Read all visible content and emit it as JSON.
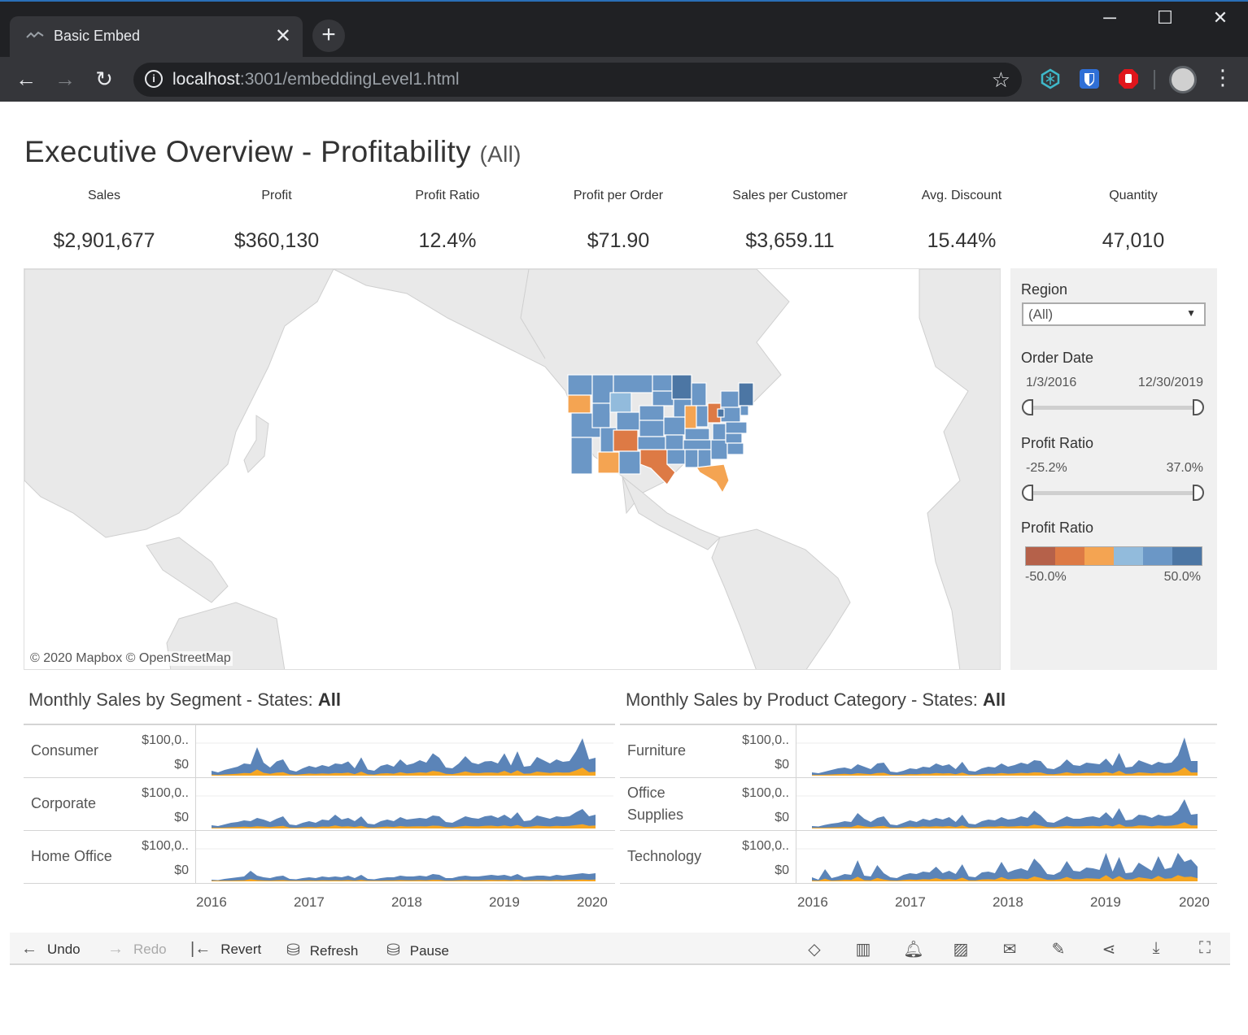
{
  "browser": {
    "tab_title": "Basic Embed",
    "url_host": "localhost",
    "url_rest": ":3001/embeddingLevel1.html"
  },
  "dashboard": {
    "title": "Executive Overview - Profitability",
    "title_suffix": "(All)",
    "kpis": [
      {
        "label": "Sales",
        "value": "$2,901,677"
      },
      {
        "label": "Profit",
        "value": "$360,130"
      },
      {
        "label": "Profit Ratio",
        "value": "12.4%"
      },
      {
        "label": "Profit per Order",
        "value": "$71.90"
      },
      {
        "label": "Sales per Customer",
        "value": "$3,659.11"
      },
      {
        "label": "Avg. Discount",
        "value": "15.44%"
      },
      {
        "label": "Quantity",
        "value": "47,010"
      }
    ],
    "map_attribution": "© 2020 Mapbox  © OpenStreetMap",
    "filters": {
      "region_label": "Region",
      "region_value": "(All)",
      "order_date_label": "Order Date",
      "order_date_min": "1/3/2016",
      "order_date_max": "12/30/2019",
      "profit_ratio_label": "Profit Ratio",
      "profit_ratio_min": "-25.2%",
      "profit_ratio_max": "37.0%",
      "legend_label": "Profit Ratio",
      "legend_min": "-50.0%",
      "legend_max": "50.0%",
      "legend_colors": [
        "#b5614a",
        "#dd7a45",
        "#f4a452",
        "#92bbdc",
        "#6b97c6",
        "#4c76a4"
      ]
    },
    "segment_chart": {
      "title_prefix": "Monthly Sales by Segment - States: ",
      "title_value": "All",
      "rows": [
        "Consumer",
        "Corporate",
        "Home Office"
      ],
      "y_top": "$100,0..",
      "y_bottom": "$0"
    },
    "category_chart": {
      "title_prefix": "Monthly Sales by Product Category - States: ",
      "title_value": "All",
      "rows": [
        "Furniture",
        "Office\nSupplies",
        "Technology"
      ],
      "y_top": "$100,0..",
      "y_bottom": "$0"
    },
    "x_ticks": [
      "2016",
      "2017",
      "2018",
      "2019",
      "2020"
    ],
    "colors": {
      "sales": "#5b84b8",
      "profit": "#f5a623"
    }
  },
  "chart_data": [
    {
      "type": "area",
      "title": "Monthly Sales by Segment - States: All",
      "x_ticks": [
        "2016",
        "2017",
        "2018",
        "2019",
        "2020"
      ],
      "series_rows": [
        {
          "name": "Consumer",
          "sales": [
            12,
            8,
            14,
            18,
            22,
            30,
            28,
            70,
            32,
            20,
            35,
            40,
            14,
            10,
            18,
            24,
            20,
            26,
            22,
            30,
            28,
            35,
            18,
            45,
            15,
            12,
            24,
            28,
            22,
            40,
            26,
            30,
            38,
            32,
            55,
            44,
            20,
            18,
            30,
            48,
            32,
            28,
            35,
            36,
            30,
            55,
            25,
            60,
            22,
            24,
            46,
            38,
            30,
            40,
            34,
            36,
            60,
            92,
            40,
            44
          ]
        },
        {
          "name": "Corporate",
          "sales": [
            8,
            6,
            10,
            14,
            16,
            20,
            18,
            26,
            22,
            16,
            24,
            30,
            10,
            8,
            14,
            18,
            14,
            22,
            20,
            34,
            22,
            26,
            18,
            30,
            12,
            10,
            18,
            22,
            18,
            28,
            22,
            24,
            26,
            24,
            32,
            30,
            16,
            14,
            22,
            30,
            26,
            24,
            30,
            32,
            26,
            34,
            24,
            40,
            18,
            20,
            32,
            28,
            24,
            30,
            28,
            30,
            40,
            48,
            30,
            34
          ]
        },
        {
          "name": "Home Office",
          "sales": [
            4,
            3,
            6,
            8,
            10,
            12,
            26,
            14,
            10,
            8,
            12,
            14,
            6,
            5,
            8,
            10,
            8,
            12,
            10,
            12,
            10,
            14,
            8,
            16,
            6,
            5,
            8,
            10,
            10,
            14,
            12,
            12,
            14,
            12,
            18,
            16,
            8,
            8,
            12,
            14,
            12,
            12,
            14,
            16,
            14,
            16,
            12,
            18,
            10,
            12,
            14,
            14,
            12,
            16,
            14,
            16,
            18,
            20,
            18,
            20
          ]
        }
      ]
    },
    {
      "type": "area",
      "title": "Monthly Sales by Product Category - States: All",
      "x_ticks": [
        "2016",
        "2017",
        "2018",
        "2019",
        "2020"
      ],
      "series_rows": [
        {
          "name": "Furniture",
          "sales": [
            8,
            6,
            10,
            14,
            18,
            20,
            16,
            28,
            22,
            16,
            30,
            32,
            10,
            8,
            12,
            18,
            16,
            22,
            20,
            30,
            24,
            28,
            16,
            34,
            12,
            10,
            18,
            22,
            20,
            30,
            22,
            26,
            32,
            28,
            38,
            36,
            18,
            16,
            24,
            40,
            26,
            24,
            32,
            30,
            28,
            42,
            24,
            56,
            20,
            22,
            38,
            32,
            26,
            34,
            30,
            32,
            50,
            94,
            36,
            36
          ]
        },
        {
          "name": "Office Supplies",
          "sales": [
            6,
            5,
            9,
            12,
            14,
            18,
            16,
            38,
            24,
            16,
            26,
            30,
            10,
            8,
            14,
            20,
            16,
            24,
            20,
            26,
            22,
            28,
            16,
            34,
            12,
            10,
            18,
            22,
            20,
            28,
            22,
            24,
            30,
            26,
            44,
            32,
            16,
            14,
            22,
            30,
            24,
            24,
            28,
            30,
            26,
            40,
            24,
            50,
            20,
            22,
            34,
            32,
            26,
            34,
            30,
            32,
            44,
            72,
            34,
            36
          ]
        },
        {
          "name": "Technology",
          "sales": [
            10,
            4,
            30,
            8,
            12,
            18,
            16,
            52,
            14,
            12,
            40,
            20,
            10,
            8,
            16,
            20,
            18,
            24,
            22,
            36,
            20,
            26,
            18,
            42,
            12,
            10,
            22,
            24,
            20,
            48,
            22,
            28,
            32,
            26,
            56,
            40,
            18,
            16,
            24,
            50,
            26,
            24,
            34,
            32,
            28,
            70,
            24,
            60,
            20,
            22,
            46,
            36,
            26,
            62,
            30,
            34,
            70,
            48,
            54,
            36
          ]
        }
      ]
    }
  ]
}
